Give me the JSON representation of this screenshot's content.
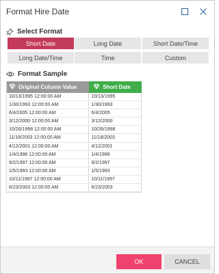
{
  "window": {
    "title": "Format Hire Date"
  },
  "select_format": {
    "label": "Select Format",
    "icon": "pin-icon",
    "options": [
      {
        "label": "Short Date",
        "selected": true
      },
      {
        "label": "Long Date",
        "selected": false
      },
      {
        "label": "Short Date/Time",
        "selected": false
      },
      {
        "label": "Long Date/Time",
        "selected": false
      },
      {
        "label": "Time",
        "selected": false
      },
      {
        "label": "Custom",
        "selected": false
      }
    ]
  },
  "format_sample": {
    "label": "Format Sample",
    "icon": "eye-icon",
    "columns": [
      {
        "label": "Original Column Value",
        "icon": "diamond-icon"
      },
      {
        "label": "Short Date",
        "icon": "diamond-icon"
      }
    ],
    "rows": [
      [
        "10/13/1995 12:00:00 AM",
        "10/13/1995"
      ],
      [
        "1/30/1993 12:00:00 AM",
        "1/30/1993"
      ],
      [
        "6/4/2005 12:00:00 AM",
        "6/4/2005"
      ],
      [
        "3/12/2000 12:00:00 AM",
        "3/12/2000"
      ],
      [
        "10/26/1998 12:00:00 AM",
        "10/26/1998"
      ],
      [
        "11/18/2003 12:00:00 AM",
        "11/18/2003"
      ],
      [
        "4/12/2001 12:00:00 AM",
        "4/12/2001"
      ],
      [
        "1/4/1996 12:00:00 AM",
        "1/4/1996"
      ],
      [
        "9/2/1997 12:00:00 AM",
        "9/2/1997"
      ],
      [
        "1/5/1993 12:00:00 AM",
        "1/5/1993"
      ],
      [
        "10/11/1997 12:00:00 AM",
        "10/11/1997"
      ],
      [
        "6/23/2003 12:00:00 AM",
        "6/23/2003"
      ]
    ]
  },
  "footer": {
    "ok_label": "OK",
    "cancel_label": "CANCEL"
  },
  "colors": {
    "selected_format": "#c43a5a",
    "ok_button": "#f0426e",
    "sample_header_original": "#9a9a9a",
    "sample_header_target": "#3fad49"
  }
}
